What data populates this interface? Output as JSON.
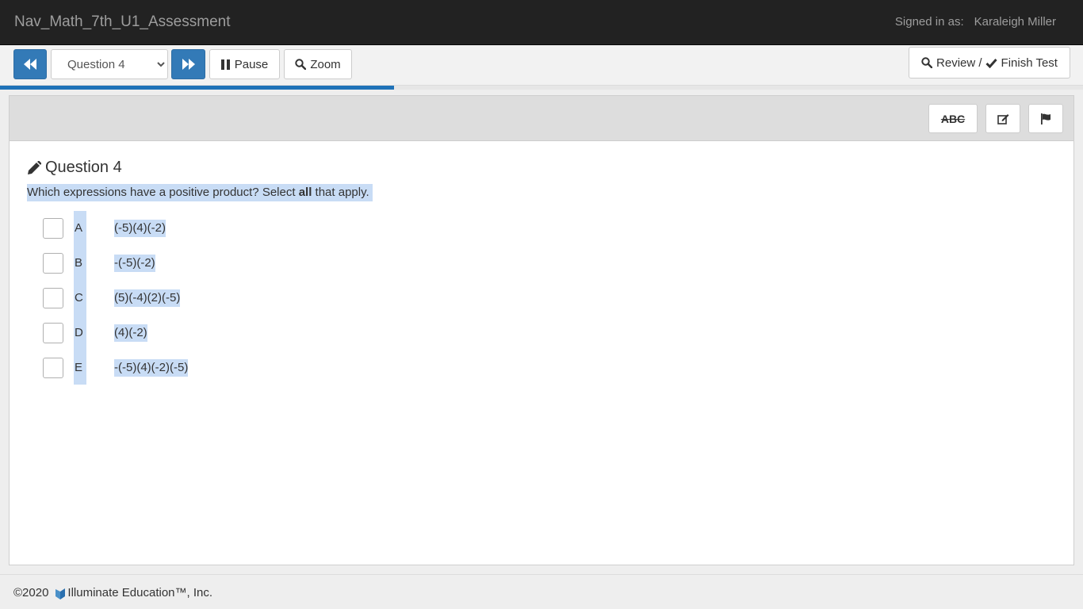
{
  "header": {
    "title": "Nav_Math_7th_U1_Assessment",
    "signed_in_label": "Signed in as:",
    "user_name": "Karaleigh Miller"
  },
  "toolbar": {
    "question_select": {
      "selected": "Question 4"
    },
    "pause_label": "Pause",
    "zoom_label": "Zoom",
    "review_label": "Review /",
    "finish_label": "Finish Test",
    "progress_fraction": 0.364
  },
  "panel_tools": {
    "abc_label": "ABC",
    "icons": [
      "strikethrough-abc",
      "edit-icon",
      "flag-icon"
    ]
  },
  "question": {
    "title": "Question 4",
    "prompt_before": "Which expressions have a positive product? Select ",
    "prompt_bold": "all",
    "prompt_after": " that apply.",
    "options": [
      {
        "letter": "A",
        "expression": "(-5)(4)(-2)",
        "checked": false
      },
      {
        "letter": "B",
        "expression": "-(-5)(-2)",
        "checked": false
      },
      {
        "letter": "C",
        "expression": "(5)(-4)(2)(-5)",
        "checked": false
      },
      {
        "letter": "D",
        "expression": "(4)(-2)",
        "checked": false
      },
      {
        "letter": "E",
        "expression": "-(-5)(4)(-2)(-5)",
        "checked": false
      }
    ]
  },
  "footer": {
    "copyright_year": "©2020",
    "company": "Illuminate Education™, Inc."
  },
  "colors": {
    "navbar": "#222222",
    "primary": "#337ab7",
    "highlight": "#c8dcf5"
  }
}
